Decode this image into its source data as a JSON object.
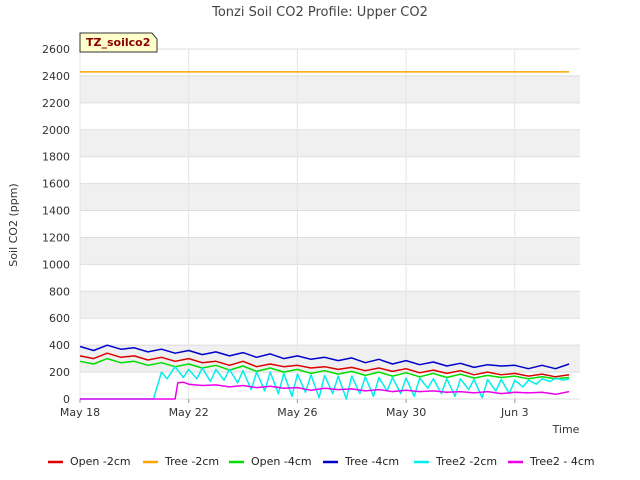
{
  "chart_data": {
    "type": "line",
    "title": "Tonzi Soil CO2 Profile: Upper CO2",
    "badge": "TZ_soilco2",
    "xlabel": "Time",
    "ylabel": "Soil CO2 (ppm)",
    "x_ticks": [
      {
        "day": 0,
        "label": "May 18"
      },
      {
        "day": 4,
        "label": "May 22"
      },
      {
        "day": 8,
        "label": "May 26"
      },
      {
        "day": 12,
        "label": "May 30"
      },
      {
        "day": 16,
        "label": "Jun 3"
      }
    ],
    "xlim": [
      0,
      18.4
    ],
    "ylim": [
      0,
      2600
    ],
    "y_ticks": [
      0,
      200,
      400,
      600,
      800,
      1000,
      1200,
      1400,
      1600,
      1800,
      2000,
      2200,
      2400,
      2600
    ],
    "grid": true,
    "legend_position": "bottom",
    "series": [
      {
        "name": "Open -2cm",
        "color": "#dd0000",
        "x": [
          0,
          0.5,
          1,
          1.5,
          2,
          2.5,
          3,
          3.5,
          4,
          4.5,
          5,
          5.5,
          6,
          6.5,
          7,
          7.5,
          8,
          8.5,
          9,
          9.5,
          10,
          10.5,
          11,
          11.5,
          12,
          12.5,
          13,
          13.5,
          14,
          14.5,
          15,
          15.5,
          16,
          16.5,
          17,
          17.5,
          18
        ],
        "y": [
          320,
          300,
          340,
          310,
          320,
          290,
          310,
          280,
          300,
          270,
          280,
          250,
          280,
          240,
          260,
          240,
          250,
          230,
          240,
          220,
          235,
          210,
          230,
          205,
          225,
          195,
          215,
          190,
          210,
          180,
          200,
          180,
          190,
          170,
          185,
          165,
          180
        ]
      },
      {
        "name": "Tree -2cm",
        "color": "#ffa500",
        "x": [
          0,
          18
        ],
        "y": [
          2430,
          2430
        ]
      },
      {
        "name": "Open -4cm",
        "color": "#00dd00",
        "x": [
          0,
          0.5,
          1,
          1.5,
          2,
          2.5,
          3,
          3.5,
          4,
          4.5,
          5,
          5.5,
          6,
          6.5,
          7,
          7.5,
          8,
          8.5,
          9,
          9.5,
          10,
          10.5,
          11,
          11.5,
          12,
          12.5,
          13,
          13.5,
          14,
          14.5,
          15,
          15.5,
          16,
          16.5,
          17,
          17.5,
          18
        ],
        "y": [
          280,
          260,
          300,
          270,
          280,
          250,
          270,
          240,
          260,
          230,
          250,
          215,
          245,
          205,
          230,
          200,
          220,
          190,
          210,
          185,
          205,
          175,
          200,
          170,
          195,
          165,
          190,
          160,
          185,
          155,
          175,
          160,
          170,
          150,
          165,
          150,
          160
        ]
      },
      {
        "name": "Tree -4cm",
        "color": "#0000cc",
        "x": [
          0,
          0.5,
          1,
          1.5,
          2,
          2.5,
          3,
          3.5,
          4,
          4.5,
          5,
          5.5,
          6,
          6.5,
          7,
          7.5,
          8,
          8.5,
          9,
          9.5,
          10,
          10.5,
          11,
          11.5,
          12,
          12.5,
          13,
          13.5,
          14,
          14.5,
          15,
          15.5,
          16,
          16.5,
          17,
          17.5,
          18
        ],
        "y": [
          390,
          360,
          400,
          370,
          380,
          350,
          370,
          340,
          360,
          330,
          350,
          320,
          345,
          310,
          335,
          300,
          320,
          295,
          310,
          285,
          305,
          270,
          295,
          260,
          285,
          255,
          275,
          245,
          265,
          235,
          255,
          245,
          250,
          225,
          250,
          225,
          260
        ]
      },
      {
        "name": "Tree2 -2cm",
        "color": "#00eeee",
        "x": [
          0,
          2.7,
          3,
          3.2,
          3.5,
          3.8,
          4,
          4.3,
          4.5,
          4.8,
          5,
          5.3,
          5.5,
          5.8,
          6,
          6.3,
          6.5,
          6.8,
          7,
          7.3,
          7.5,
          7.8,
          8,
          8.3,
          8.5,
          8.8,
          9,
          9.3,
          9.5,
          9.8,
          10,
          10.3,
          10.5,
          10.8,
          11,
          11.3,
          11.5,
          11.8,
          12,
          12.3,
          12.5,
          12.8,
          13,
          13.3,
          13.5,
          13.8,
          14,
          14.3,
          14.5,
          14.8,
          15,
          15.3,
          15.5,
          15.8,
          16,
          16.3,
          16.5,
          16.8,
          17,
          17.3,
          17.5,
          17.8,
          18
        ],
        "y": [
          0,
          0,
          200,
          150,
          240,
          160,
          220,
          150,
          230,
          130,
          220,
          140,
          220,
          120,
          210,
          70,
          200,
          60,
          200,
          40,
          190,
          20,
          185,
          50,
          180,
          10,
          175,
          40,
          170,
          0,
          170,
          40,
          165,
          20,
          160,
          60,
          160,
          40,
          155,
          20,
          155,
          80,
          150,
          40,
          150,
          20,
          150,
          70,
          145,
          10,
          145,
          60,
          145,
          40,
          140,
          90,
          140,
          110,
          150,
          130,
          155,
          140,
          150
        ]
      },
      {
        "name": "Tree2 - 4cm",
        "color": "#ee00ee",
        "x": [
          0,
          1,
          2,
          3.5,
          3.6,
          3.8,
          4,
          4.5,
          5,
          5.5,
          6,
          6.5,
          7,
          7.5,
          8,
          8.5,
          9,
          9.5,
          10,
          10.5,
          11,
          11.5,
          12,
          12.5,
          13,
          13.5,
          14,
          14.5,
          15,
          15.5,
          16,
          16.5,
          17,
          17.5,
          18
        ],
        "y": [
          0,
          0,
          0,
          0,
          120,
          125,
          110,
          100,
          105,
          90,
          100,
          85,
          95,
          80,
          85,
          65,
          80,
          70,
          75,
          60,
          70,
          55,
          65,
          55,
          60,
          50,
          55,
          45,
          55,
          40,
          50,
          45,
          50,
          35,
          55
        ]
      }
    ]
  }
}
